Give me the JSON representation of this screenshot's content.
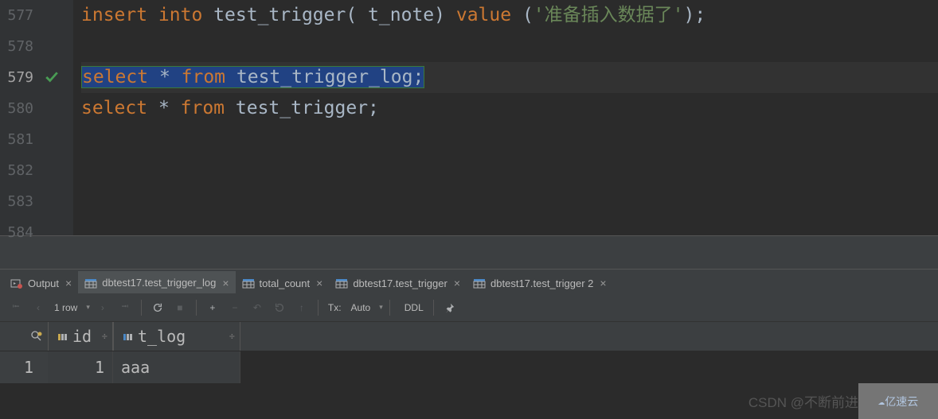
{
  "editor": {
    "lines": [
      {
        "num": "577"
      },
      {
        "num": "578"
      },
      {
        "num": "579"
      },
      {
        "num": "580"
      },
      {
        "num": "581"
      },
      {
        "num": "582"
      },
      {
        "num": "583"
      },
      {
        "num": "584"
      }
    ],
    "code": {
      "l577": {
        "kw1": "insert into",
        "id1": " test_trigger",
        "br1": "(",
        "id2": " t_note",
        "br2": ")",
        "kw2": " value ",
        "br3": "(",
        "str": "'准备插入数据了'",
        "br4": ")",
        "semi": ";"
      },
      "l579": {
        "kw": "select",
        "op": " * ",
        "kw2": "from",
        "id": " test_trigger_log",
        "semi": ";"
      },
      "l580": {
        "kw": "select",
        "op": " * ",
        "kw2": "from",
        "id": " test_trigger",
        "semi": ";"
      }
    }
  },
  "tabs": [
    {
      "label": "Output"
    },
    {
      "label": "dbtest17.test_trigger_log"
    },
    {
      "label": "total_count"
    },
    {
      "label": "dbtest17.test_trigger"
    },
    {
      "label": "dbtest17.test_trigger 2"
    }
  ],
  "toolbar": {
    "rowcount": "1 row",
    "tx": "Tx:",
    "auto": "Auto",
    "ddl": "DDL"
  },
  "result": {
    "columns": [
      {
        "name": "id"
      },
      {
        "name": "t_log"
      }
    ],
    "rows": [
      {
        "num": "1",
        "id": "1",
        "t_log": "aaa"
      }
    ]
  },
  "watermark": "CSDN @不断前进",
  "wm2": "亿速云"
}
